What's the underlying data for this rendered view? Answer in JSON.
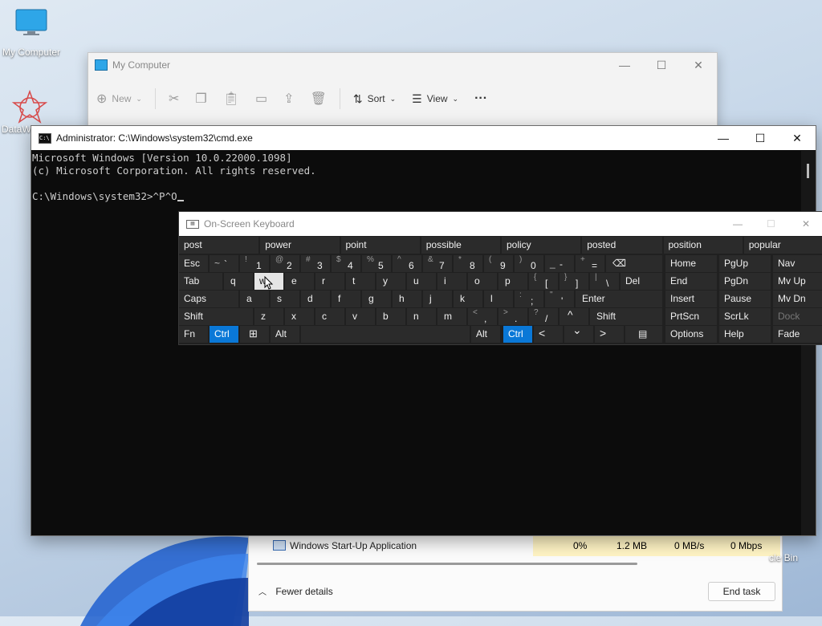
{
  "desktop": {
    "icons": [
      {
        "label": "My Computer"
      },
      {
        "label": "DataW"
      },
      {
        "label": "cle Bin"
      }
    ]
  },
  "explorer": {
    "title": "My Computer",
    "toolbar": {
      "new_label": "New",
      "sort_label": "Sort",
      "view_label": "View",
      "more_label": "···"
    }
  },
  "cmd": {
    "title": "Administrator: C:\\Windows\\system32\\cmd.exe",
    "lines": [
      "Microsoft Windows [Version 10.0.22000.1098]",
      "(c) Microsoft Corporation. All rights reserved.",
      "",
      "C:\\Windows\\system32>^P^O"
    ]
  },
  "taskmgr": {
    "row": {
      "name": "Windows Start-Up Application",
      "cpu": "0%",
      "memory": "1.2 MB",
      "disk": "0 MB/s",
      "network": "0 Mbps"
    },
    "fewer_details": "Fewer details",
    "end_task": "End task"
  },
  "osk": {
    "title": "On-Screen Keyboard",
    "predictions": [
      "post",
      "power",
      "point",
      "possible",
      "policy",
      "posted",
      "position",
      "popular"
    ],
    "row1": [
      {
        "sec": "",
        "pri": "Esc"
      },
      {
        "sec": "~",
        "pri": "`"
      },
      {
        "sec": "!",
        "pri": "1"
      },
      {
        "sec": "@",
        "pri": "2"
      },
      {
        "sec": "#",
        "pri": "3"
      },
      {
        "sec": "$",
        "pri": "4"
      },
      {
        "sec": "%",
        "pri": "5"
      },
      {
        "sec": "^",
        "pri": "6"
      },
      {
        "sec": "&",
        "pri": "7"
      },
      {
        "sec": "*",
        "pri": "8"
      },
      {
        "sec": "(",
        "pri": "9"
      },
      {
        "sec": ")",
        "pri": "0"
      },
      {
        "sec": "_",
        "pri": "-"
      },
      {
        "sec": "+",
        "pri": "="
      },
      {
        "sec": "",
        "pri": "⌫"
      }
    ],
    "row2": [
      "Tab",
      "q",
      "w",
      "e",
      "r",
      "t",
      "y",
      "u",
      "i",
      "o",
      "p",
      "[",
      "]",
      "\\",
      "Del"
    ],
    "row2_sec": [
      "",
      "",
      "",
      "",
      "",
      "",
      "",
      "",
      "",
      "",
      "",
      "{",
      "}",
      "|",
      ""
    ],
    "row3": [
      "Caps",
      "a",
      "s",
      "d",
      "f",
      "g",
      "h",
      "j",
      "k",
      "l",
      ";",
      "'",
      "Enter"
    ],
    "row3_sec": [
      "",
      "",
      "",
      "",
      "",
      "",
      "",
      "",
      "",
      "",
      ":",
      "\"",
      ""
    ],
    "row4": [
      "Shift",
      "z",
      "x",
      "c",
      "v",
      "b",
      "n",
      "m",
      ",",
      ".",
      "/",
      "^",
      "Shift"
    ],
    "row4_sec": [
      "",
      "",
      "",
      "",
      "",
      "",
      "",
      "",
      "<",
      ">",
      "?",
      "",
      ""
    ],
    "row5": [
      "Fn",
      "Ctrl",
      "⊞",
      "Alt",
      "",
      "Alt",
      "Ctrl",
      "<",
      "⌄",
      ">",
      "▤"
    ],
    "right_keys": [
      [
        "Home",
        "PgUp",
        "Nav"
      ],
      [
        "End",
        "PgDn",
        "Mv Up"
      ],
      [
        "Insert",
        "Pause",
        "Mv Dn"
      ],
      [
        "PrtScn",
        "ScrLk",
        "Dock"
      ],
      [
        "Options",
        "Help",
        "Fade"
      ]
    ]
  },
  "colors": {
    "accent": "#0a78d7",
    "console_bg": "#0c0c0c",
    "osk_bg": "#202020",
    "key_bg": "#2b2b2b"
  }
}
